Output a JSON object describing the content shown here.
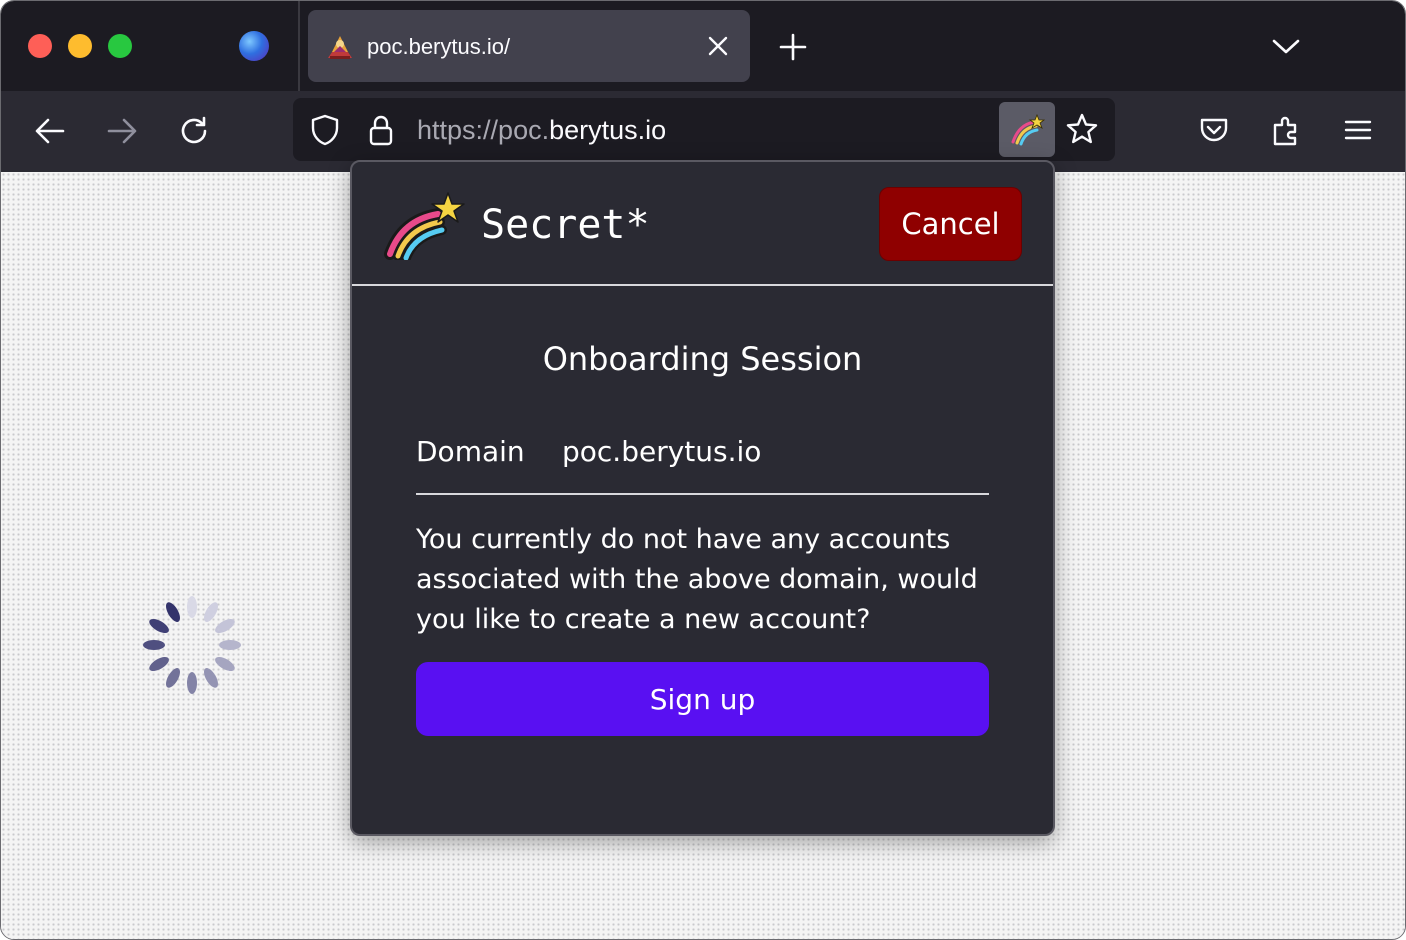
{
  "browser": {
    "tab": {
      "title": "poc.berytus.io/",
      "favicon": "berytus-favicon-icon"
    },
    "url": {
      "scheme": "https://",
      "subdomain": "poc.",
      "domain": "berytus.io"
    },
    "colors": {
      "tab_strip": "#1c1b22",
      "toolbar": "#2b2a33",
      "active_tab": "#42414d"
    }
  },
  "popup": {
    "brand": "Secret*",
    "cancel_label": "Cancel",
    "title": "Onboarding Session",
    "domain_label": "Domain",
    "domain_value": "poc.berytus.io",
    "message": "You currently do not have any accounts associated with the above domain, would you like to create a new account?",
    "signup_label": "Sign up",
    "colors": {
      "cancel": "#8f0000",
      "signup": "#5910f2",
      "background": "#2a2a33"
    }
  }
}
